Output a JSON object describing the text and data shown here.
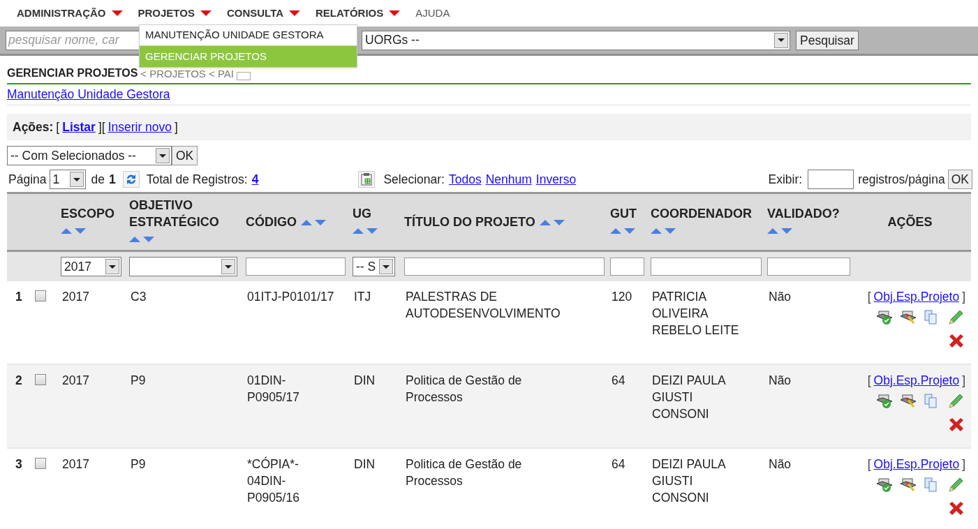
{
  "nav": [
    {
      "label": "ADMINISTRAÇÃO",
      "dropdown": true
    },
    {
      "label": "PROJETOS",
      "dropdown": true
    },
    {
      "label": "CONSULTA",
      "dropdown": true
    },
    {
      "label": "RELATÓRIOS",
      "dropdown": true
    },
    {
      "label": "AJUDA",
      "dropdown": false
    }
  ],
  "menu": [
    {
      "label": "MANUTENÇÃO UNIDADE GESTORA",
      "selected": false
    },
    {
      "label": "GERENCIAR PROJETOS",
      "selected": true
    }
  ],
  "search": {
    "placeholder": "pesquisar nome, car",
    "select_value": "UORGs --",
    "button": "Pesquisar"
  },
  "breadcrumb": {
    "title": "GERENCIAR PROJETOS",
    "trail": "< PROJETOS < PAI"
  },
  "sublink": "Manutenção Unidade Gestora",
  "actions": {
    "label": "Ações:",
    "items": [
      {
        "kind": "text",
        "text": "["
      },
      {
        "kind": "link",
        "text": "Listar",
        "selected": true
      },
      {
        "kind": "text",
        "text": "]["
      },
      {
        "kind": "link",
        "text": "Inserir novo",
        "selected": false
      },
      {
        "kind": "text",
        "text": "]"
      }
    ]
  },
  "bulk": {
    "select_value": "-- Com Selecionados --",
    "button": "OK"
  },
  "pager": {
    "page_label": "Página",
    "page": "1",
    "of_label": "de",
    "pages": "1",
    "total_label": "Total de Registros:",
    "total": "4",
    "select_label": "Selecionar:",
    "select_links": [
      "Todos",
      "Nenhum",
      "Inverso"
    ],
    "show_label": "Exibir:",
    "per_page_label": "registros/página",
    "button": "OK"
  },
  "columns": [
    {
      "label": "ESCOPO",
      "sortable": true,
      "filter": {
        "kind": "select",
        "value": "2017"
      }
    },
    {
      "label": "OBJETIVO ESTRATÉGICO",
      "sortable": true,
      "filter": {
        "kind": "select"
      }
    },
    {
      "label": "CÓDIGO",
      "sortable": true,
      "filter": {
        "kind": "input"
      }
    },
    {
      "label": "UG",
      "sortable": true,
      "filter": {
        "kind": "select",
        "value": "-- S"
      }
    },
    {
      "label": "TÍTULO DO PROJETO",
      "sortable": true,
      "filter": {
        "kind": "input"
      }
    },
    {
      "label": "GUT",
      "sortable": true,
      "filter": {
        "kind": "input"
      }
    },
    {
      "label": "COORDENADOR",
      "sortable": true,
      "filter": {
        "kind": "input"
      }
    },
    {
      "label": "VALIDADO?",
      "sortable": true,
      "filter": {
        "kind": "input"
      }
    },
    {
      "label": "AÇÕES",
      "sortable": false,
      "filter": {
        "kind": "none"
      }
    }
  ],
  "rows": [
    {
      "number": "1",
      "checked": false,
      "escopo": "2017",
      "objetivo": "C3",
      "code_lines": [
        "01ITJ-P0101/17"
      ],
      "ug": "ITJ",
      "titulo": "PALESTRAS DE AUTODESENVOLVIMENTO",
      "gut": "120",
      "coordenador": "PATRICIA OLIVEIRA REBELO LEITE",
      "validado": "Não",
      "link": {
        "open": "[",
        "label": "Obj.Esp.Projeto",
        "close": "]"
      }
    },
    {
      "number": "2",
      "checked": false,
      "escopo": "2017",
      "objetivo": "P9",
      "code_lines": [
        "01DIN-",
        "P0905/17"
      ],
      "ug": "DIN",
      "titulo": "Politica de Gestão de Processos",
      "gut": "64",
      "coordenador": "DEIZI PAULA GIUSTI CONSONI",
      "validado": "Não",
      "link": {
        "open": "[",
        "label": "Obj.Esp.Projeto",
        "close": "]"
      }
    },
    {
      "number": "3",
      "checked": false,
      "escopo": "2017",
      "objetivo": "P9",
      "code_lines": [
        "*CÓPIA*-",
        "04DIN-",
        "P0905/16"
      ],
      "ug": "DIN",
      "titulo": "Politica de Gestão de Processos",
      "gut": "64",
      "coordenador": "DEIZI PAULA GIUSTI CONSONI",
      "validado": "Não",
      "link": {
        "open": "[",
        "label": "Obj.Esp.Projeto",
        "close": "]"
      }
    }
  ]
}
